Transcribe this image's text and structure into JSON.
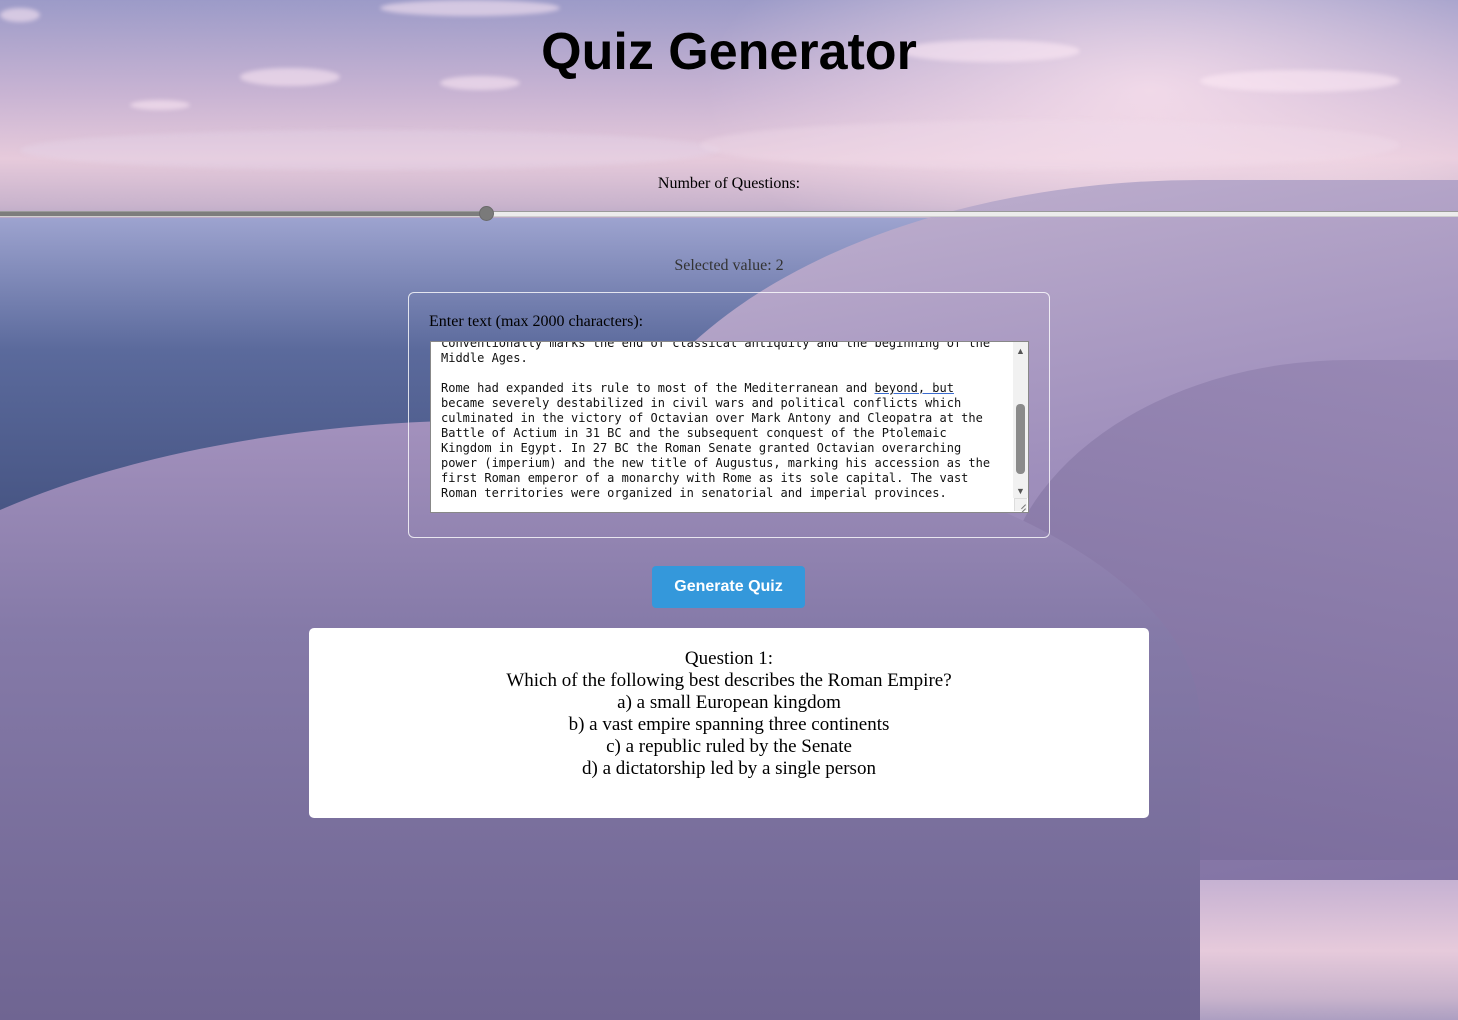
{
  "page": {
    "title": "Quiz Generator"
  },
  "slider": {
    "label": "Number of Questions:",
    "selected_text": "Selected value: 2",
    "fill_fraction": 0.333
  },
  "text_input": {
    "label": "Enter text (max 2000 characters):",
    "lines": [
      "conventionally marks the end of classical antiquity and the beginning of the",
      "Middle Ages.",
      "",
      "Rome had expanded its rule to most of the Mediterranean and beyond, but",
      "became severely destabilized in civil wars and political conflicts which",
      "culminated in the victory of Octavian over Mark Antony and Cleopatra at the",
      "Battle of Actium in 31 BC and the subsequent conquest of the Ptolemaic",
      "Kingdom in Egypt. In 27 BC the Roman Senate granted Octavian overarching",
      "power (imperium) and the new title of Augustus, marking his accession as the",
      "first Roman emperor of a monarchy with Rome as its sole capital. The vast",
      "Roman territories were organized in senatorial and imperial provinces."
    ]
  },
  "actions": {
    "generate_label": "Generate Quiz"
  },
  "quiz": {
    "question_heading": "Question 1:",
    "question_text": "Which of the following best describes the Roman Empire?",
    "options": [
      "a) a small European kingdom",
      "b) a vast empire spanning three continents",
      "c) a republic ruled by the Senate",
      "d) a dictatorship led by a single person"
    ]
  },
  "colors": {
    "button": "#3498db",
    "slider_fill": "#7d7d7d"
  }
}
